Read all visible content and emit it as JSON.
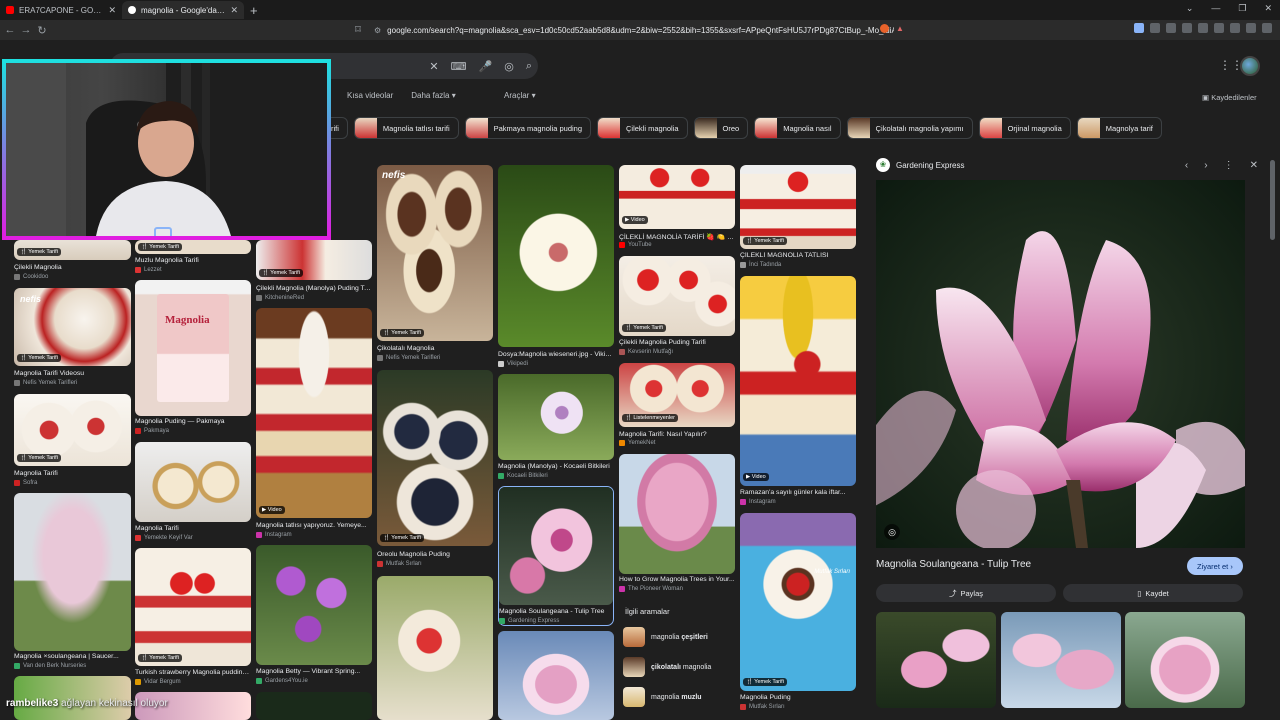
{
  "browser": {
    "tabs": [
      {
        "title": "ERA7CAPONE - GODFATHER (OFFICIA",
        "active": false,
        "favicon_color": "#ff0000"
      },
      {
        "title": "magnolia - Google'da Ara",
        "active": true,
        "favicon_color": "#ffffff"
      }
    ],
    "url": "google.com/search?q=magnolia&sca_esv=1d0c50cd52aab5d8&udm=2&biw=2552&bih=1355&sxsrf=APpeQntFsHU5J7rPDg87CtBup_-Mo_idiA%3A178..."
  },
  "search": {
    "filters": [
      "Kısa videolar",
      "Daha fazla",
      "Araçlar"
    ],
    "saved_label": "Kaydedilenler",
    "chips": [
      "rifi",
      "Magnolia tatlısı tarifi",
      "Pakmaya magnolia puding",
      "Çilekli magnolia",
      "Oreo",
      "Magnolia nasıl",
      "Çikolatalı magnolia yapımı",
      "Orjinal magnolia",
      "Magnolya tarif"
    ]
  },
  "results": {
    "col1": [
      {
        "title": "Çilekli Magnolia",
        "source": "Cookidoo",
        "badge": "Yemek Tarifi"
      },
      {
        "title": "Magnolia Tarifi Videosu",
        "source": "Nefis Yemek Tarifleri",
        "badge": "Yemek Tarifi"
      },
      {
        "title": "Magnolia Tarifi",
        "source": "Sofra",
        "badge": "Yemek Tarifi"
      },
      {
        "title": "Magnolia ×soulangeana | Saucer...",
        "source": "Van den Berk Nurseries",
        "badge": ""
      }
    ],
    "col2": [
      {
        "title": "Muzlu Magnolia Tarifi",
        "source": "Lezzet",
        "badge": "Yemek Tarifi"
      },
      {
        "title": "Magnolia Puding — Pakmaya",
        "source": "Pakmaya",
        "badge": ""
      },
      {
        "title": "Magnolia Tarifi",
        "source": "Yemekte Keyif Var",
        "badge": ""
      },
      {
        "title": "Turkish strawberry Magnolia pudding...",
        "source": "Vidar Bergum",
        "badge": "Yemek Tarifi"
      }
    ],
    "col3": [
      {
        "title": "Çilekli Magnolia (Manolya) Puding Tarifi",
        "source": "KitchenineRed",
        "badge": "Yemek Tarifi"
      },
      {
        "title": "Magnolia tatlısı yapıyoruz. Yemeye...",
        "source": "Instagram",
        "badge": "Video"
      },
      {
        "title": "Magnolia Betty — Vibrant Spring...",
        "source": "Gardens4You.ie",
        "badge": ""
      }
    ],
    "col4": [
      {
        "title": "Çikolatalı Magnolia",
        "source": "Nefis Yemek Tarifleri",
        "badge": "Yemek Tarifi"
      },
      {
        "title": "Oreolu Magnolia Puding",
        "source": "Mutfak Sırları",
        "badge": "Yemek Tarifi"
      }
    ],
    "col5": [
      {
        "title": "Dosya:Magnolia wieseneri.jpg - Vikipedi",
        "source": "Vikipedi",
        "badge": ""
      },
      {
        "title": "Magnolia (Manolya) - Kocaeli Bitkileri",
        "source": "Kocaeli Bitkileri",
        "badge": ""
      },
      {
        "title": "Magnolia Soulangeana - Tulip Tree",
        "source": "Gardening Express",
        "badge": ""
      }
    ],
    "col6": [
      {
        "title": "ÇİLEKLİ MAGNOLİA TARİFİ 🍓 🍋 EN...",
        "source": "YouTube",
        "badge": "Video"
      },
      {
        "title": "Çilekli Magnolia Puding Tarifi",
        "source": "Kevserin Mutfağı",
        "badge": "Yemek Tarifi"
      },
      {
        "title": "Magnolia Tarifi: Nasıl Yapılır?",
        "source": "YemekNet",
        "badge": "Listelenmeyenler"
      },
      {
        "title": "How to Grow Magnolia Trees in Your...",
        "source": "The Pioneer Woman",
        "badge": ""
      }
    ],
    "col7": [
      {
        "title": "ÇİLEKLİ MAGNOLİA TATLISI",
        "source": "İnci Tadında",
        "badge": "Yemek Tarifi"
      },
      {
        "title": "Ramazan'a sayılı günler kala iftar...",
        "source": "Instagram",
        "badge": "Video"
      },
      {
        "title": "Magnolia Puding",
        "source": "Mutfak Sırları",
        "badge": "Yemek Tarifi"
      }
    ],
    "card_text": {
      "nefis_logo": "nefis",
      "sosyal": "Mutfak Sırları"
    }
  },
  "related": {
    "heading": "İlgili aramalar",
    "items": [
      {
        "pre": "magnolia ",
        "bold": "çeşitleri"
      },
      {
        "pre": "",
        "bold": "çikolatalı",
        "post": " magnolia"
      },
      {
        "pre": "magnolia ",
        "bold": "muzlu"
      }
    ]
  },
  "panel": {
    "source": "Gardening Express",
    "title": "Magnolia Soulangeana - Tulip Tree",
    "visit_label": "Ziyaret et",
    "share_label": "Paylaş",
    "save_label": "Kaydet"
  },
  "overlay": {
    "chat_user": "rambelike3",
    "chat_text": " ağlayan kekinasıl oluyor"
  },
  "colors": {
    "background": "#1f1f1f",
    "accent": "#a8c7fa",
    "text": "#e8eaed",
    "muted": "#9aa0a6"
  }
}
